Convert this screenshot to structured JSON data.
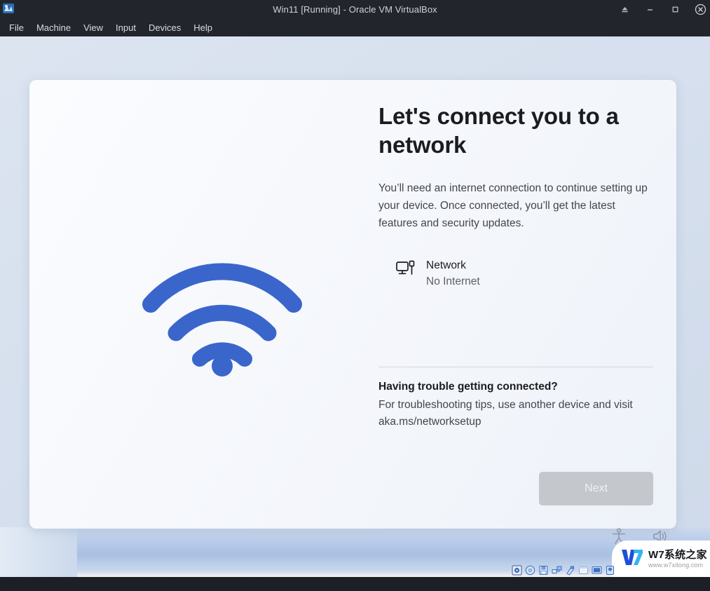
{
  "window": {
    "title": "Win11 [Running] - Oracle VM VirtualBox",
    "app_icon": "virtualbox-icon",
    "controls": [
      {
        "name": "eject-button",
        "glyph": "⏏"
      },
      {
        "name": "minimize-button",
        "glyph": "–"
      },
      {
        "name": "restore-button",
        "glyph": "❐"
      },
      {
        "name": "close-button",
        "glyph": "⊗"
      }
    ],
    "menus": [
      {
        "label": "File"
      },
      {
        "label": "Machine"
      },
      {
        "label": "View"
      },
      {
        "label": "Input"
      },
      {
        "label": "Devices"
      },
      {
        "label": "Help"
      }
    ]
  },
  "oobe": {
    "art_icon": "wifi-icon",
    "heading": "Let's connect you to a network",
    "body": "You’ll need an internet connection to continue setting up your device. Once connected, you’ll get the latest features and security updates.",
    "network": {
      "icon": "wired-network-icon",
      "name": "Network",
      "status": "No Internet"
    },
    "trouble": {
      "title": "Having trouble getting connected?",
      "body": "For troubleshooting tips, use another device and visit aka.ms/networksetup"
    },
    "next_button": {
      "label": "Next",
      "enabled": false
    }
  },
  "guest_tray": [
    {
      "name": "accessibility-icon"
    },
    {
      "name": "volume-icon"
    }
  ],
  "watermark": {
    "mark": "w7-logo-icon",
    "title": "W7系统之家",
    "url": "www.w7xitong.com"
  },
  "status_bar": {
    "icons": [
      {
        "name": "hard-disk-icon"
      },
      {
        "name": "optical-drive-icon"
      },
      {
        "name": "floppy-drive-icon"
      },
      {
        "name": "network-adapter-icon"
      },
      {
        "name": "usb-icon"
      },
      {
        "name": "shared-folders-icon"
      },
      {
        "name": "display-icon"
      },
      {
        "name": "recording-icon"
      }
    ]
  },
  "colors": {
    "accent_blue": "#3a66cc",
    "chrome_dark": "#22262c",
    "card_bg": "#f7f9fc",
    "disabled_button": "#c4c7cc",
    "heading_text": "#1b1c1f",
    "body_text": "#42474d"
  }
}
